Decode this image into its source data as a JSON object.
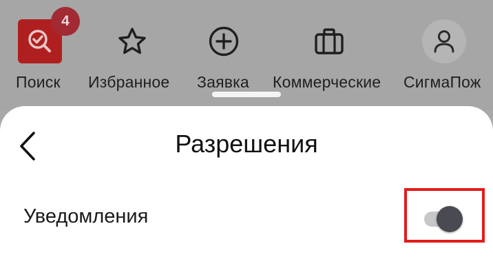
{
  "nav": {
    "search": {
      "label": "Поиск",
      "badge": "4",
      "icon": "search-check-icon"
    },
    "favorites": {
      "label": "Избранное",
      "icon": "star-icon"
    },
    "request": {
      "label": "Заявка",
      "icon": "plus-circle-icon"
    },
    "commercial": {
      "label": "Коммерческие",
      "icon": "briefcase-icon"
    },
    "profile": {
      "label": "СигмаПож",
      "icon": "user-icon"
    }
  },
  "sheet": {
    "title": "Разрешения",
    "back_icon": "chevron-left-icon",
    "notifications": {
      "label": "Уведомления",
      "enabled": true
    }
  },
  "colors": {
    "accent": "#b01f1f",
    "highlight": "#e51a1a",
    "overlay": "#a6a6a6"
  }
}
